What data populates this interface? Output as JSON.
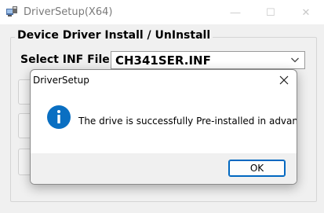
{
  "window": {
    "title": "DriverSetup(X64)",
    "controls": {
      "minimize": "—",
      "maximize": "☐",
      "close": "✕"
    }
  },
  "main": {
    "group_title": "Device Driver Install / UnInstall",
    "inf_label": "Select INF File :",
    "inf_value": "CH341SER.INF",
    "inf_dropdown_icon": "chevron-down-icon"
  },
  "dialog": {
    "title": "DriverSetup",
    "message": "The drive is successfully Pre-installed in advance!",
    "icon": "info-icon",
    "ok_label": "OK",
    "close_label": "✕",
    "accent": "#0067c0"
  }
}
